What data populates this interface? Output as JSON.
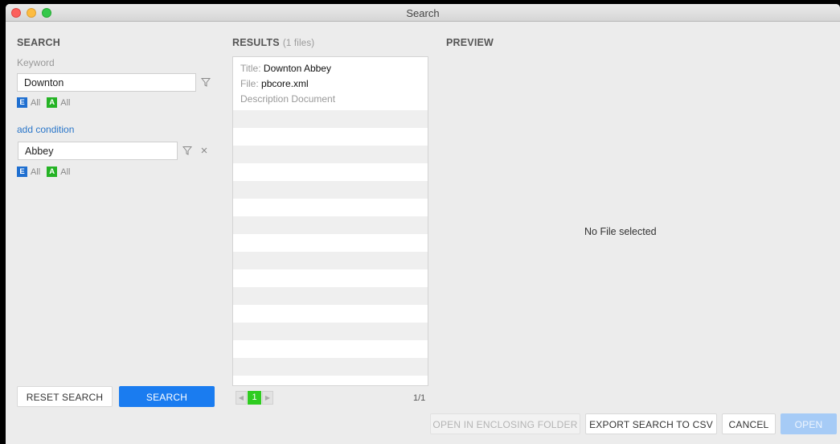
{
  "window": {
    "title": "Search"
  },
  "search": {
    "title": "SEARCH",
    "keyword_label": "Keyword",
    "keyword_value": "Downton",
    "keyword_scope": {
      "e_badge": "E",
      "e_text": "All",
      "a_badge": "A",
      "a_text": "All"
    },
    "add_condition": "add condition",
    "condition_value": "Abbey",
    "condition_scope": {
      "e_badge": "E",
      "e_text": "All",
      "a_badge": "A",
      "a_text": "All"
    },
    "reset_label": "RESET SEARCH",
    "search_label": "SEARCH"
  },
  "results": {
    "title": "RESULTS",
    "count_text": "(1 files)",
    "items": [
      {
        "title_key": "Title:",
        "title_value": "Downton Abbey",
        "file_key": "File:",
        "file_value": "pbcore.xml",
        "description": "Description Document"
      }
    ],
    "pagination": {
      "prev": "◀",
      "page": "1",
      "next": "▶",
      "count": "1/1"
    }
  },
  "preview": {
    "title": "PREVIEW",
    "empty_text": "No File selected"
  },
  "footer": {
    "open_folder": "OPEN IN ENCLOSING FOLDER",
    "export_csv": "EXPORT SEARCH TO CSV",
    "cancel": "CANCEL",
    "open": "OPEN"
  },
  "colors": {
    "accent": "#1a7cf0",
    "e_badge": "#1f6fd0",
    "a_badge": "#25b325",
    "page_active": "#2ecc1f"
  }
}
